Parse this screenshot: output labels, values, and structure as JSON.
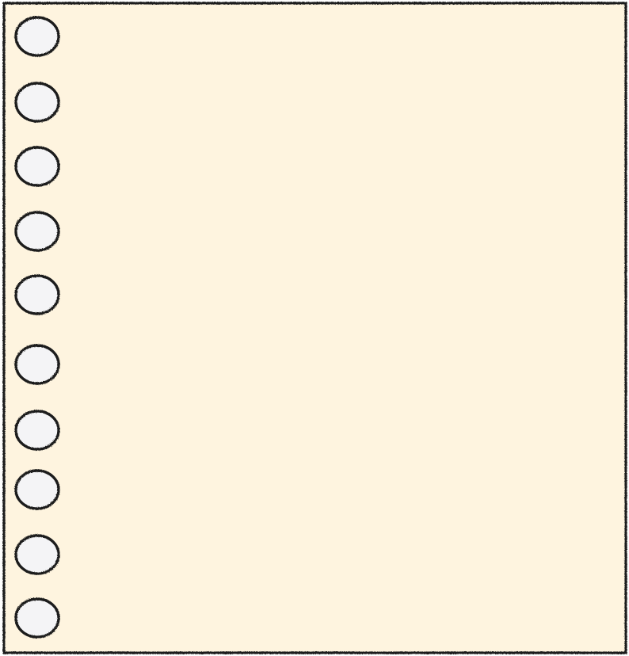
{
  "paper": {
    "fill_color": "#fef4df",
    "border_color": "#1a1a1a",
    "hole_fill_color": "#f4f4f6",
    "hole_stroke_color": "#1a1a1a"
  },
  "binder_holes": {
    "count": 10,
    "icon": "binder-hole-icon"
  }
}
